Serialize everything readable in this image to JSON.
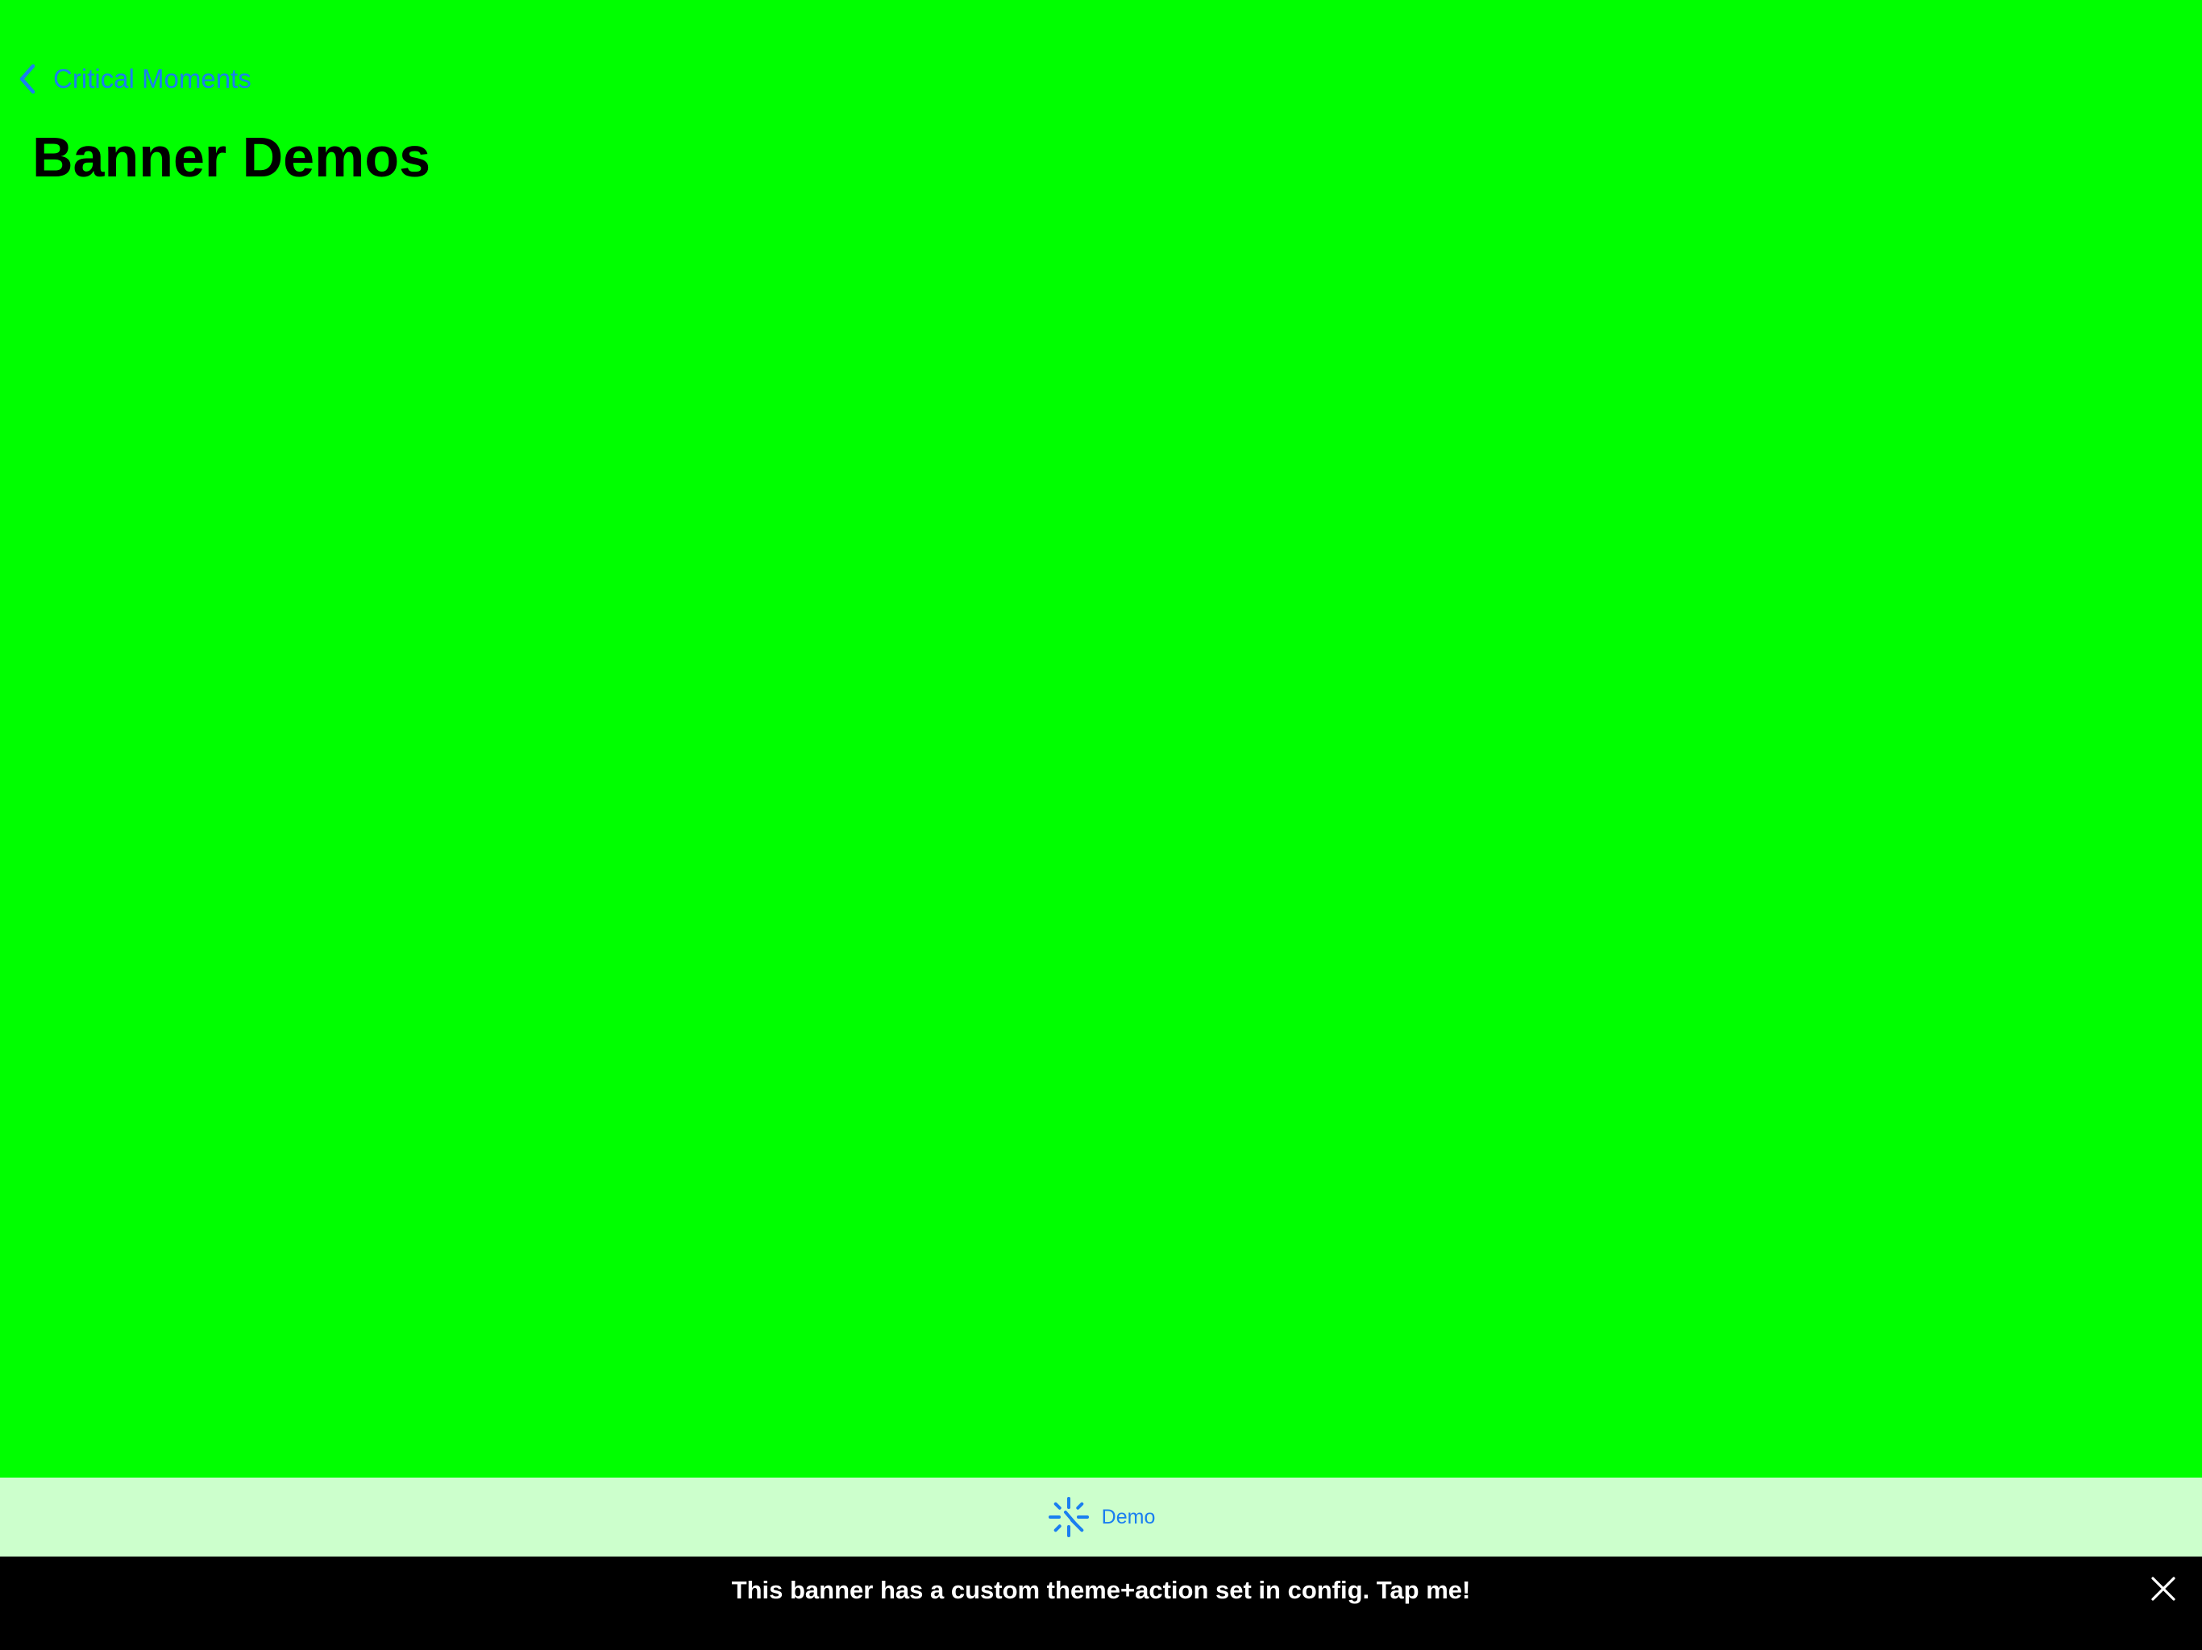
{
  "colors": {
    "background": "#00ff00",
    "tabbar_background": "#ccffcc",
    "accent": "#1a7ef0",
    "banner_background": "#000000",
    "banner_text": "#ffffff",
    "title_text": "#000000"
  },
  "nav": {
    "back_icon": "chevron-left-icon",
    "back_label": "Critical Moments"
  },
  "page": {
    "title": "Banner Demos"
  },
  "tabbar": {
    "items": [
      {
        "icon": "loading-spinner-icon",
        "label": "Demo",
        "selected": true
      }
    ]
  },
  "banner": {
    "message": "This banner has a custom theme+action set in config. Tap me!",
    "close_icon": "close-icon"
  }
}
